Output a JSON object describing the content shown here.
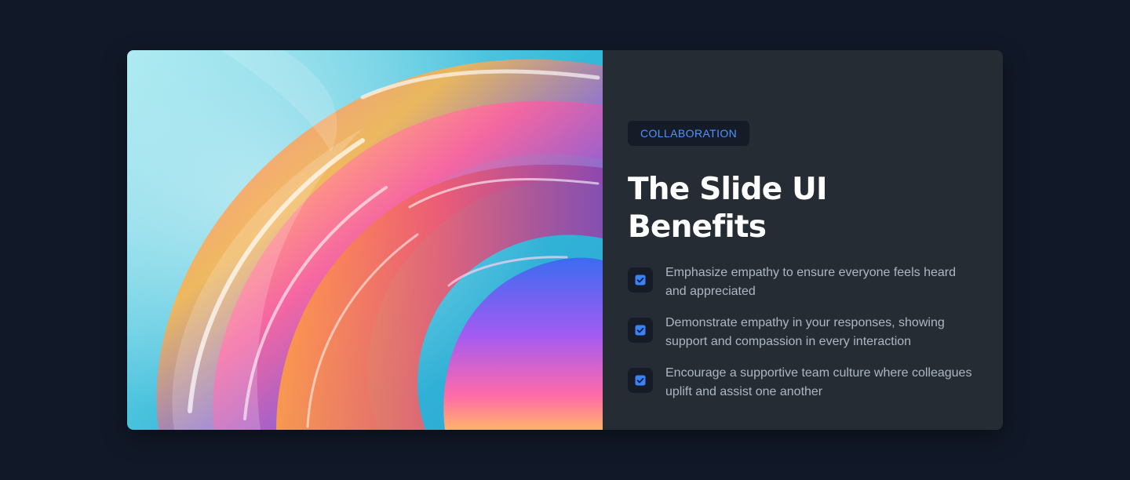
{
  "slide": {
    "tag": "COLLABORATION",
    "title": "The Slide UI Benefits",
    "benefits": [
      {
        "text": "Emphasize empathy to ensure everyone feels heard and appreciated",
        "icon": "checkbox-checked-icon"
      },
      {
        "text": "Demonstrate empathy in your responses, showing support and compassion in every interaction",
        "icon": "checkbox-checked-icon"
      },
      {
        "text": "Encourage a supportive team culture where colleagues uplift and assist one another",
        "icon": "checkbox-checked-icon"
      }
    ]
  },
  "colors": {
    "page_background": "#111827",
    "card_background": "#252c33",
    "accent": "#4f93ff",
    "badge_background": "#151c28"
  }
}
